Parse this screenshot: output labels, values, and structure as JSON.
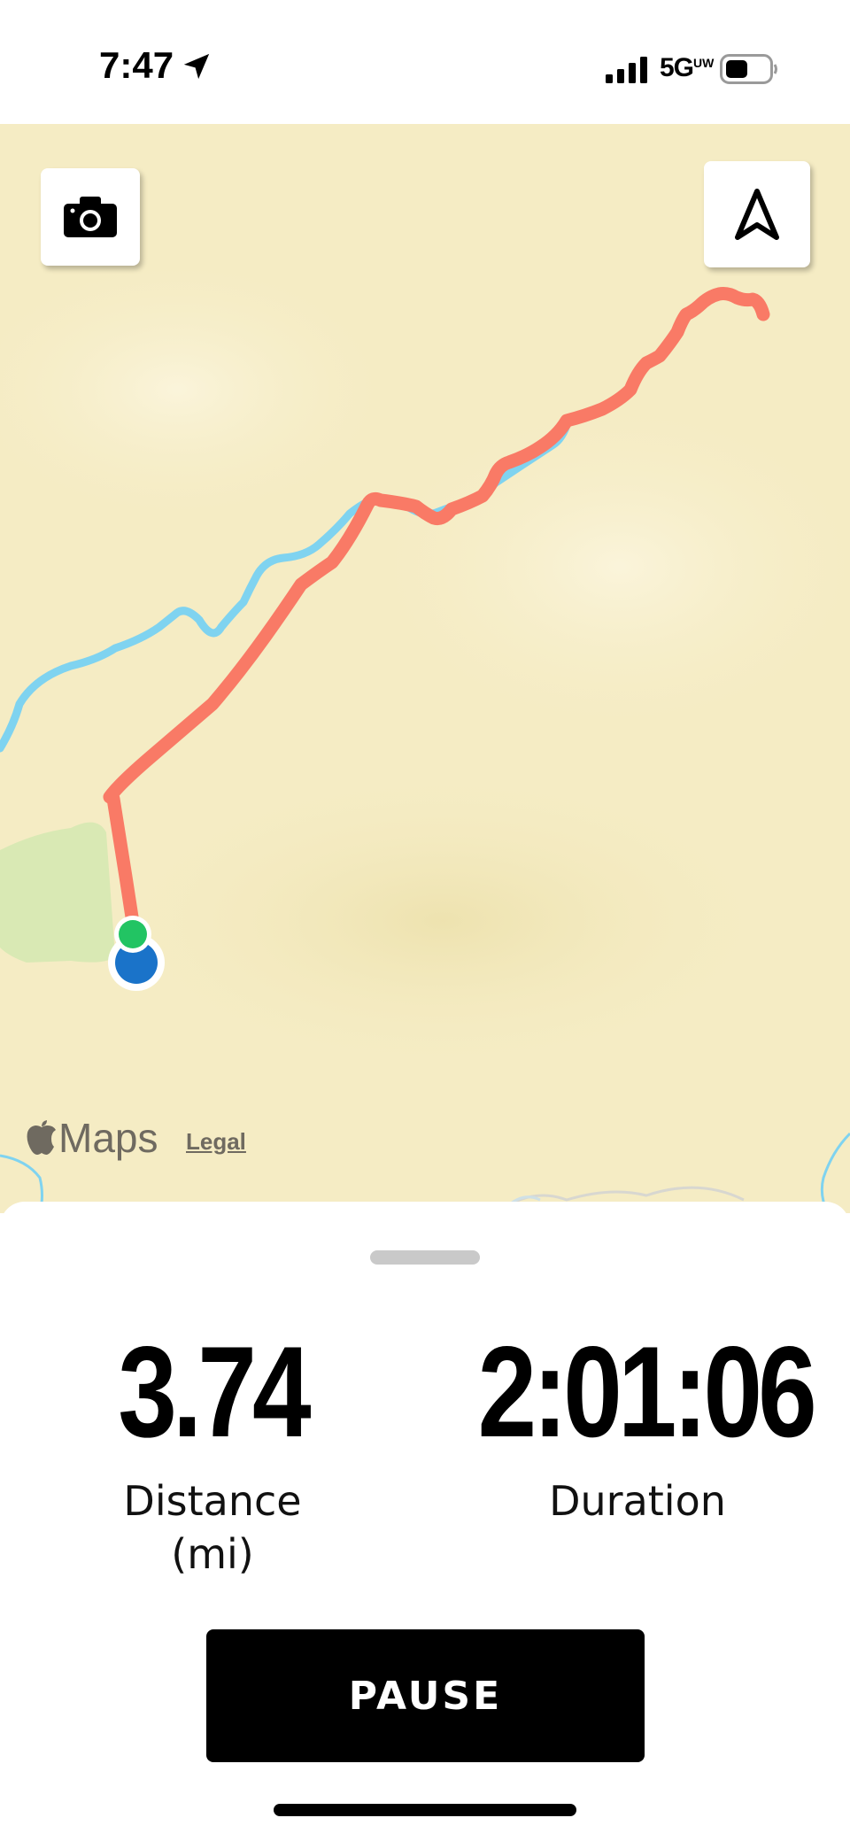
{
  "status_bar": {
    "time": "7:47",
    "network": "5G",
    "network_superscript": "UW",
    "icons": [
      "location-arrow-icon",
      "signal-icon",
      "battery-icon"
    ]
  },
  "map": {
    "attribution": "Maps",
    "legal_label": "Legal",
    "colors": {
      "terrain": "#f5ecc4",
      "route": "#f97a66",
      "water": "#7fd3f0",
      "park": "#d9e9b4",
      "start_marker": "#22c463",
      "current_location": "#1a73c9"
    },
    "icons": [
      "camera-icon",
      "navigation-arrow-icon",
      "apple-icon"
    ]
  },
  "stats": {
    "distance_value": "3.74",
    "distance_label": "Distance",
    "distance_unit": "(mi)",
    "duration_value": "2:01:06",
    "duration_label": "Duration"
  },
  "controls": {
    "pause_label": "PAUSE"
  }
}
